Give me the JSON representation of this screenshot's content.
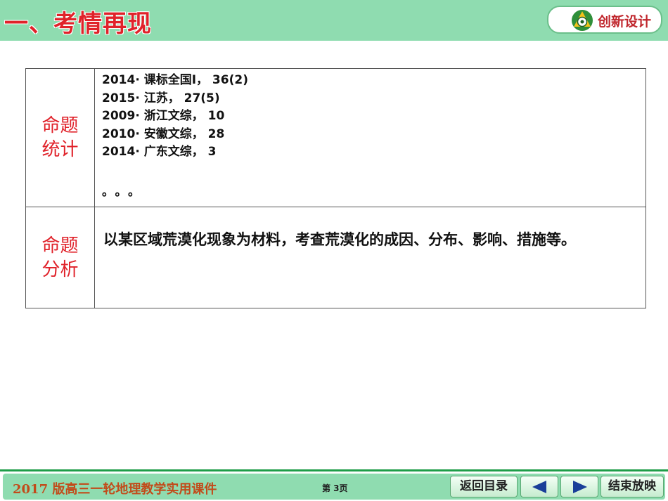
{
  "header": {
    "title": "一、考情再现",
    "logo_text": "创新设计"
  },
  "table": {
    "rows": [
      {
        "label": [
          "命题",
          "统计"
        ],
        "items": [
          "2014· 课标全国Ⅰ， 36(2)",
          "2015· 江苏， 27(5)",
          "2009· 浙江文综， 10",
          "2010· 安徽文综， 28",
          "2014· 广东文综， 3"
        ],
        "ellipsis": "。。。"
      },
      {
        "label": [
          "命题",
          "分析"
        ],
        "text": "以某区域荒漠化现象为材料，考查荒漠化的成因、分布、影响、措施等。"
      }
    ]
  },
  "footer": {
    "course": "2017 版高三一轮地理教学实用课件",
    "page": "第 3页",
    "return_label": "返回目录",
    "end_label": "结束放映",
    "prev_icon": "triangle-left-icon",
    "next_icon": "triangle-right-icon"
  },
  "colors": {
    "header_bg": "#8fdcb0",
    "title_red": "#e0222a",
    "footer_text": "#c24b1a",
    "nav_arrow": "#1a3f99"
  }
}
